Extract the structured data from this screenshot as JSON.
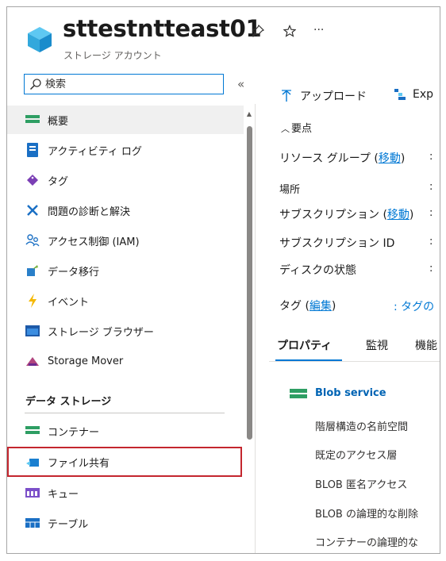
{
  "header": {
    "title": "sttestntteast01",
    "subtitle": "ストレージ アカウント",
    "icons": [
      "storage-account-icon",
      "pin-icon",
      "star-icon",
      "more-icon"
    ]
  },
  "search": {
    "placeholder": "検索"
  },
  "nav": {
    "items": [
      {
        "label": "概要",
        "icon": "overview-icon",
        "active": true
      },
      {
        "label": "アクティビティ ログ",
        "icon": "activity-log-icon"
      },
      {
        "label": "タグ",
        "icon": "tag-icon"
      },
      {
        "label": "問題の診断と解決",
        "icon": "diagnose-icon"
      },
      {
        "label": "アクセス制御 (IAM)",
        "icon": "iam-icon"
      },
      {
        "label": "データ移行",
        "icon": "data-migration-icon"
      },
      {
        "label": "イベント",
        "icon": "events-icon"
      },
      {
        "label": "ストレージ ブラウザー",
        "icon": "storage-browser-icon"
      },
      {
        "label": "Storage Mover",
        "icon": "storage-mover-icon"
      }
    ],
    "section": "データ ストレージ",
    "section_items": [
      {
        "label": "コンテナー",
        "icon": "container-icon"
      },
      {
        "label": "ファイル共有",
        "icon": "file-share-icon",
        "highlighted": true
      },
      {
        "label": "キュー",
        "icon": "queue-icon"
      },
      {
        "label": "テーブル",
        "icon": "table-icon"
      }
    ]
  },
  "toolbar": {
    "upload": "アップロード",
    "explorer": "Exp"
  },
  "essentials": {
    "toggle": "要点",
    "resource_group": "リソース グループ (",
    "move_link": "移動",
    "close_paren": ")",
    "location": "場所",
    "subscription": "サブスクリプション (",
    "subscription_id": "サブスクリプション ID",
    "disk_state": "ディスクの状態",
    "tags": "タグ (",
    "edit_link": "編集",
    "tags_value": ": タグの",
    "colon": ":"
  },
  "tabs": {
    "properties": "プロパティ",
    "monitoring": "監視",
    "features": "機能"
  },
  "blob": {
    "title": "Blob service",
    "props": [
      "階層構造の名前空間",
      "既定のアクセス層",
      "BLOB 匿名アクセス",
      "BLOB の論理的な削除",
      "コンテナーの論理的な"
    ]
  },
  "colors": {
    "accent": "#0078d4",
    "highlight_border": "#c4262e",
    "active_bg": "#f0f0f0"
  }
}
